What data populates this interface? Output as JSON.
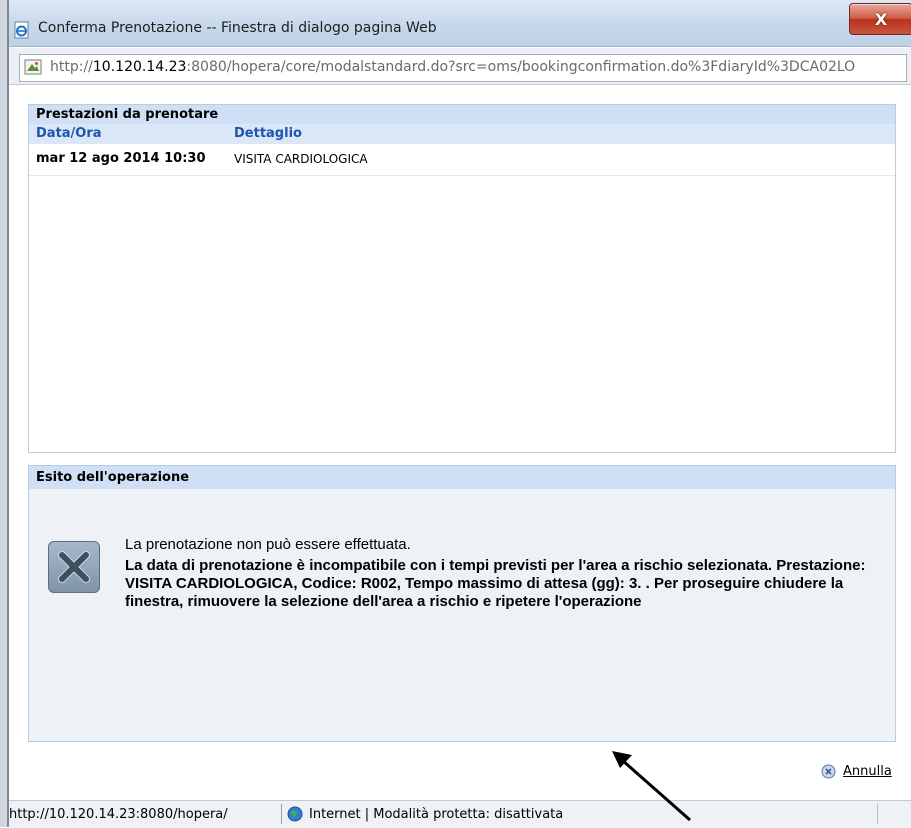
{
  "window": {
    "title": "Conferma Prenotazione -- Finestra di dialogo pagina Web",
    "close_label": "X"
  },
  "address": {
    "prefix": "http://",
    "host": "10.120.14.23",
    "rest": ":8080/hopera/core/modalstandard.do?src=oms/bookingconfirmation.do%3FdiaryId%3DCA02LO"
  },
  "bookings_panel": {
    "header": "Prestazioni da prenotare",
    "columns": [
      "Data/Ora",
      "Dettaglio"
    ],
    "rows": [
      {
        "datetime": "mar 12 ago 2014 10:30",
        "detail": "VISITA CARDIOLOGICA"
      }
    ]
  },
  "result_panel": {
    "header": "Esito dell'operazione",
    "message_line1": "La prenotazione non può essere effettuata.",
    "message_detail": "La data di prenotazione è incompatibile con i tempi previsti per l'area a rischio selezionata. Prestazione: VISITA CARDIOLOGICA, Codice: R002, Tempo massimo di attesa (gg): 3. . Per proseguire chiudere la finestra, rimuovere la selezione dell'area a rischio e ripetere l'operazione"
  },
  "actions": {
    "cancel_label": "Annulla"
  },
  "status_bar": {
    "url": "http://10.120.14.23:8080/hopera/",
    "zone": "Internet | Modalità protetta: disattivata"
  },
  "icons": [
    "ie-page-icon",
    "address-page-icon",
    "error-x-icon",
    "cancel-circle-icon",
    "globe-icon"
  ],
  "colors": {
    "panel_header": "#cfe0f6",
    "column_header_text": "#1a56b0",
    "close_button": "#c9553e"
  }
}
